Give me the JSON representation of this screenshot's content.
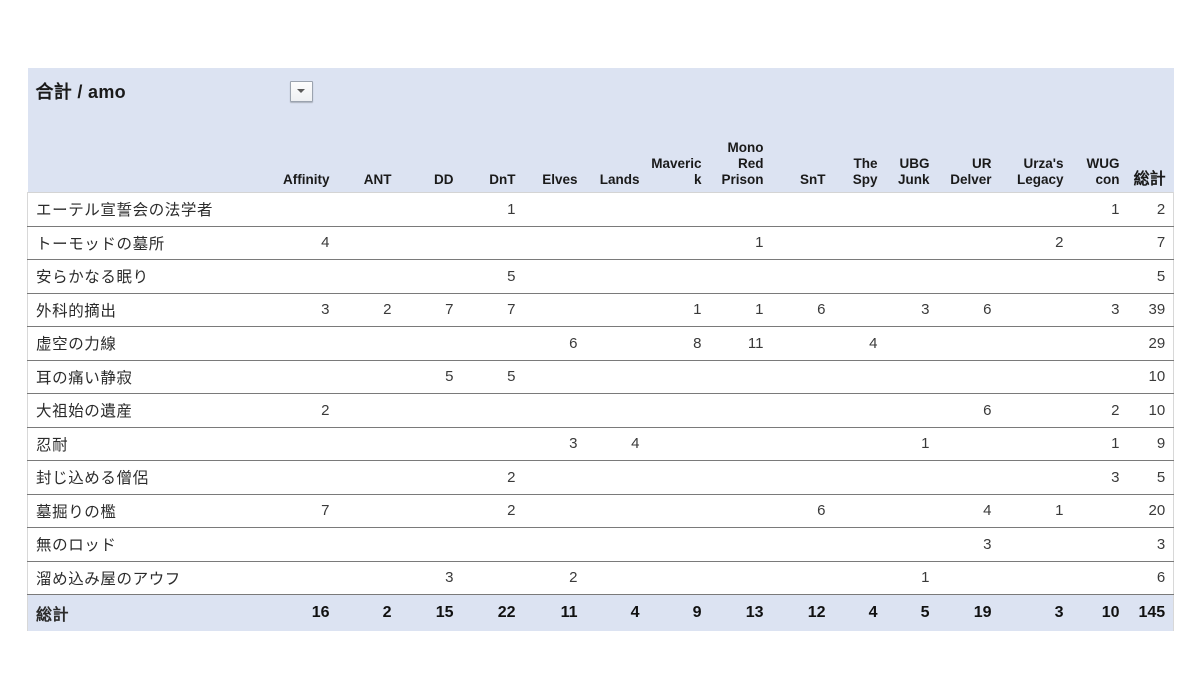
{
  "pivot": {
    "title": "合計 / amo",
    "dropdown_icon": "chevron-down-icon",
    "filter_icon": "filter-funnel-icon",
    "row_header_label": "",
    "columns": [
      "Affinity",
      "ANT",
      "DD",
      "DnT",
      "Elves",
      "Lands",
      "Maverick",
      "Mono Red Prison",
      "SnT",
      "The Spy",
      "UBG Junk",
      "UR Delver",
      "Urza's Legacy",
      "WUG con",
      "総計"
    ],
    "rows": [
      {
        "label": "エーテル宣誓会の法学者",
        "values": [
          "",
          "",
          "",
          "1",
          "",
          "",
          "",
          "",
          "",
          "",
          "",
          "",
          "",
          "1",
          "2"
        ]
      },
      {
        "label": "トーモッドの墓所",
        "values": [
          "4",
          "",
          "",
          "",
          "",
          "",
          "",
          "1",
          "",
          "",
          "",
          "",
          "2",
          "",
          "7"
        ]
      },
      {
        "label": "安らかなる眠り",
        "values": [
          "",
          "",
          "",
          "5",
          "",
          "",
          "",
          "",
          "",
          "",
          "",
          "",
          "",
          "",
          "5"
        ]
      },
      {
        "label": "外科的摘出",
        "values": [
          "3",
          "2",
          "7",
          "7",
          "",
          "",
          "1",
          "1",
          "6",
          "",
          "3",
          "6",
          "",
          "3",
          "39"
        ]
      },
      {
        "label": "虚空の力線",
        "values": [
          "",
          "",
          "",
          "",
          "6",
          "",
          "8",
          "11",
          "",
          "4",
          "",
          "",
          "",
          "",
          "29"
        ]
      },
      {
        "label": "耳の痛い静寂",
        "values": [
          "",
          "",
          "5",
          "5",
          "",
          "",
          "",
          "",
          "",
          "",
          "",
          "",
          "",
          "",
          "10"
        ]
      },
      {
        "label": "大祖始の遺産",
        "values": [
          "2",
          "",
          "",
          "",
          "",
          "",
          "",
          "",
          "",
          "",
          "",
          "6",
          "",
          "2",
          "10"
        ]
      },
      {
        "label": "忍耐",
        "values": [
          "",
          "",
          "",
          "",
          "3",
          "4",
          "",
          "",
          "",
          "",
          "1",
          "",
          "",
          "1",
          "9"
        ]
      },
      {
        "label": "封じ込める僧侶",
        "values": [
          "",
          "",
          "",
          "2",
          "",
          "",
          "",
          "",
          "",
          "",
          "",
          "",
          "",
          "3",
          "5"
        ]
      },
      {
        "label": "墓掘りの檻",
        "values": [
          "7",
          "",
          "",
          "2",
          "",
          "",
          "",
          "",
          "6",
          "",
          "",
          "4",
          "1",
          "",
          "20"
        ]
      },
      {
        "label": "無のロッド",
        "values": [
          "",
          "",
          "",
          "",
          "",
          "",
          "",
          "",
          "",
          "",
          "",
          "3",
          "",
          "",
          "3"
        ]
      },
      {
        "label": "溜め込み屋のアウフ",
        "values": [
          "",
          "",
          "3",
          "",
          "2",
          "",
          "",
          "",
          "",
          "",
          "1",
          "",
          "",
          "",
          "6"
        ]
      }
    ],
    "total_row": {
      "label": "総計",
      "values": [
        "16",
        "2",
        "15",
        "22",
        "11",
        "4",
        "9",
        "13",
        "12",
        "4",
        "5",
        "19",
        "3",
        "10",
        "145"
      ]
    },
    "colors": {
      "header_background": "#dce3f2",
      "body_background": "#ffffff",
      "text": "#262626",
      "row_divider": "#7a7a7a"
    }
  }
}
